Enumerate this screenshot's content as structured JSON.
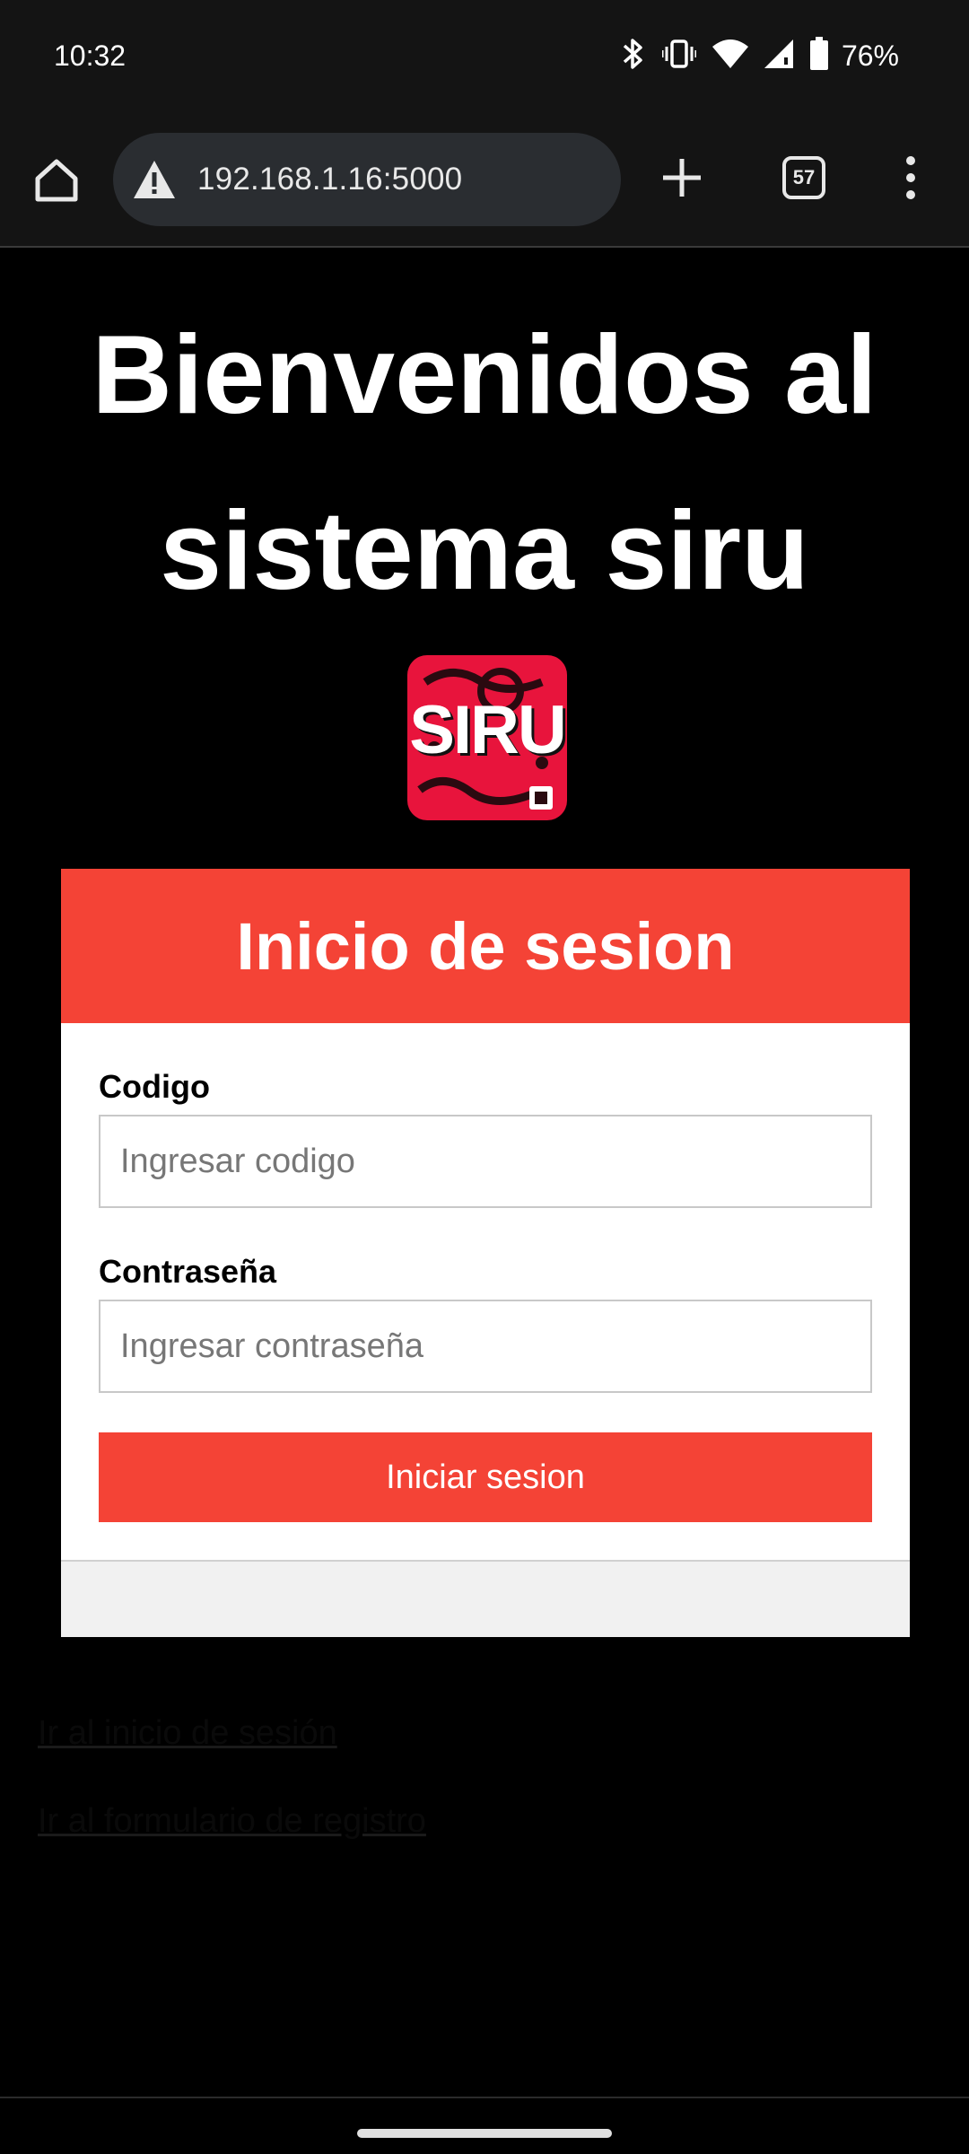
{
  "status_bar": {
    "time": "10:32",
    "battery": "76%",
    "icons": [
      "bluetooth-icon",
      "vibrate-icon",
      "wifi-icon",
      "signal-icon",
      "battery-icon"
    ]
  },
  "browser": {
    "url": "192.168.1.16:5000",
    "tab_count": "57",
    "icons": [
      "home-icon",
      "warning-icon",
      "plus-icon",
      "tabs-icon",
      "more-vert-icon"
    ]
  },
  "page": {
    "title": "Bienvenidos al sistema siru",
    "logo_text": "SIRU",
    "login_card": {
      "title": "Inicio de sesion",
      "code_label": "Codigo",
      "code_placeholder": "Ingresar codigo",
      "password_label": "Contraseña",
      "password_placeholder": "Ingresar contraseña",
      "submit_label": "Iniciar sesion"
    },
    "links": {
      "login": "Ir al inicio de sesión",
      "register": "Ir al formulario de registro"
    }
  },
  "colors": {
    "accent": "#f44336",
    "logo_bg": "#e8143c",
    "background": "#000000",
    "toolbar": "#141414"
  }
}
